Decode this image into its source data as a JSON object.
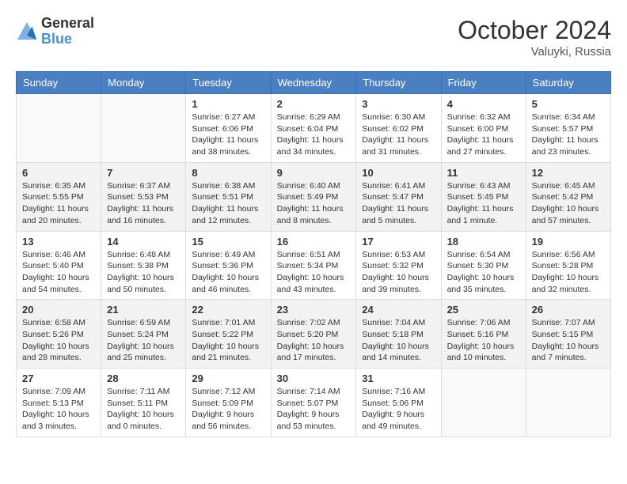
{
  "logo": {
    "general": "General",
    "blue": "Blue"
  },
  "header": {
    "month_year": "October 2024",
    "location": "Valuyki, Russia"
  },
  "days_of_week": [
    "Sunday",
    "Monday",
    "Tuesday",
    "Wednesday",
    "Thursday",
    "Friday",
    "Saturday"
  ],
  "weeks": [
    [
      {
        "day": "",
        "info": ""
      },
      {
        "day": "",
        "info": ""
      },
      {
        "day": "1",
        "info": "Sunrise: 6:27 AM\nSunset: 6:06 PM\nDaylight: 11 hours and 38 minutes."
      },
      {
        "day": "2",
        "info": "Sunrise: 6:29 AM\nSunset: 6:04 PM\nDaylight: 11 hours and 34 minutes."
      },
      {
        "day": "3",
        "info": "Sunrise: 6:30 AM\nSunset: 6:02 PM\nDaylight: 11 hours and 31 minutes."
      },
      {
        "day": "4",
        "info": "Sunrise: 6:32 AM\nSunset: 6:00 PM\nDaylight: 11 hours and 27 minutes."
      },
      {
        "day": "5",
        "info": "Sunrise: 6:34 AM\nSunset: 5:57 PM\nDaylight: 11 hours and 23 minutes."
      }
    ],
    [
      {
        "day": "6",
        "info": "Sunrise: 6:35 AM\nSunset: 5:55 PM\nDaylight: 11 hours and 20 minutes."
      },
      {
        "day": "7",
        "info": "Sunrise: 6:37 AM\nSunset: 5:53 PM\nDaylight: 11 hours and 16 minutes."
      },
      {
        "day": "8",
        "info": "Sunrise: 6:38 AM\nSunset: 5:51 PM\nDaylight: 11 hours and 12 minutes."
      },
      {
        "day": "9",
        "info": "Sunrise: 6:40 AM\nSunset: 5:49 PM\nDaylight: 11 hours and 8 minutes."
      },
      {
        "day": "10",
        "info": "Sunrise: 6:41 AM\nSunset: 5:47 PM\nDaylight: 11 hours and 5 minutes."
      },
      {
        "day": "11",
        "info": "Sunrise: 6:43 AM\nSunset: 5:45 PM\nDaylight: 11 hours and 1 minute."
      },
      {
        "day": "12",
        "info": "Sunrise: 6:45 AM\nSunset: 5:42 PM\nDaylight: 10 hours and 57 minutes."
      }
    ],
    [
      {
        "day": "13",
        "info": "Sunrise: 6:46 AM\nSunset: 5:40 PM\nDaylight: 10 hours and 54 minutes."
      },
      {
        "day": "14",
        "info": "Sunrise: 6:48 AM\nSunset: 5:38 PM\nDaylight: 10 hours and 50 minutes."
      },
      {
        "day": "15",
        "info": "Sunrise: 6:49 AM\nSunset: 5:36 PM\nDaylight: 10 hours and 46 minutes."
      },
      {
        "day": "16",
        "info": "Sunrise: 6:51 AM\nSunset: 5:34 PM\nDaylight: 10 hours and 43 minutes."
      },
      {
        "day": "17",
        "info": "Sunrise: 6:53 AM\nSunset: 5:32 PM\nDaylight: 10 hours and 39 minutes."
      },
      {
        "day": "18",
        "info": "Sunrise: 6:54 AM\nSunset: 5:30 PM\nDaylight: 10 hours and 35 minutes."
      },
      {
        "day": "19",
        "info": "Sunrise: 6:56 AM\nSunset: 5:28 PM\nDaylight: 10 hours and 32 minutes."
      }
    ],
    [
      {
        "day": "20",
        "info": "Sunrise: 6:58 AM\nSunset: 5:26 PM\nDaylight: 10 hours and 28 minutes."
      },
      {
        "day": "21",
        "info": "Sunrise: 6:59 AM\nSunset: 5:24 PM\nDaylight: 10 hours and 25 minutes."
      },
      {
        "day": "22",
        "info": "Sunrise: 7:01 AM\nSunset: 5:22 PM\nDaylight: 10 hours and 21 minutes."
      },
      {
        "day": "23",
        "info": "Sunrise: 7:02 AM\nSunset: 5:20 PM\nDaylight: 10 hours and 17 minutes."
      },
      {
        "day": "24",
        "info": "Sunrise: 7:04 AM\nSunset: 5:18 PM\nDaylight: 10 hours and 14 minutes."
      },
      {
        "day": "25",
        "info": "Sunrise: 7:06 AM\nSunset: 5:16 PM\nDaylight: 10 hours and 10 minutes."
      },
      {
        "day": "26",
        "info": "Sunrise: 7:07 AM\nSunset: 5:15 PM\nDaylight: 10 hours and 7 minutes."
      }
    ],
    [
      {
        "day": "27",
        "info": "Sunrise: 7:09 AM\nSunset: 5:13 PM\nDaylight: 10 hours and 3 minutes."
      },
      {
        "day": "28",
        "info": "Sunrise: 7:11 AM\nSunset: 5:11 PM\nDaylight: 10 hours and 0 minutes."
      },
      {
        "day": "29",
        "info": "Sunrise: 7:12 AM\nSunset: 5:09 PM\nDaylight: 9 hours and 56 minutes."
      },
      {
        "day": "30",
        "info": "Sunrise: 7:14 AM\nSunset: 5:07 PM\nDaylight: 9 hours and 53 minutes."
      },
      {
        "day": "31",
        "info": "Sunrise: 7:16 AM\nSunset: 5:06 PM\nDaylight: 9 hours and 49 minutes."
      },
      {
        "day": "",
        "info": ""
      },
      {
        "day": "",
        "info": ""
      }
    ]
  ]
}
